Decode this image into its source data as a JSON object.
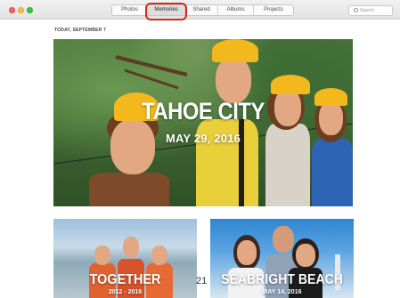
{
  "toolbar": {
    "tabs": [
      {
        "label": "Photos",
        "active": false
      },
      {
        "label": "Memories",
        "active": true
      },
      {
        "label": "Shared",
        "active": false
      },
      {
        "label": "Albums",
        "active": false
      },
      {
        "label": "Projects",
        "active": false
      }
    ],
    "search_placeholder": "Search",
    "icons": [
      "close-icon",
      "minimize-icon",
      "zoom-icon",
      "search-icon"
    ]
  },
  "colors": {
    "highlight_ring": "#d42a1e",
    "helmet": "#f2b81c",
    "traffic_close": "#fc605c",
    "traffic_minimize": "#fdbc40",
    "traffic_zoom": "#34c84a"
  },
  "main": {
    "date_header": "TODAY, SEPTEMBER 7",
    "memories": [
      {
        "title": "TAHOE CITY",
        "date": "MAY 29, 2016"
      },
      {
        "title": "TOGETHER",
        "date": "2012 - 2016"
      },
      {
        "title": "SEABRIGHT BEACH",
        "date": "MAY 14, 2016"
      }
    ],
    "count_label": "21"
  }
}
